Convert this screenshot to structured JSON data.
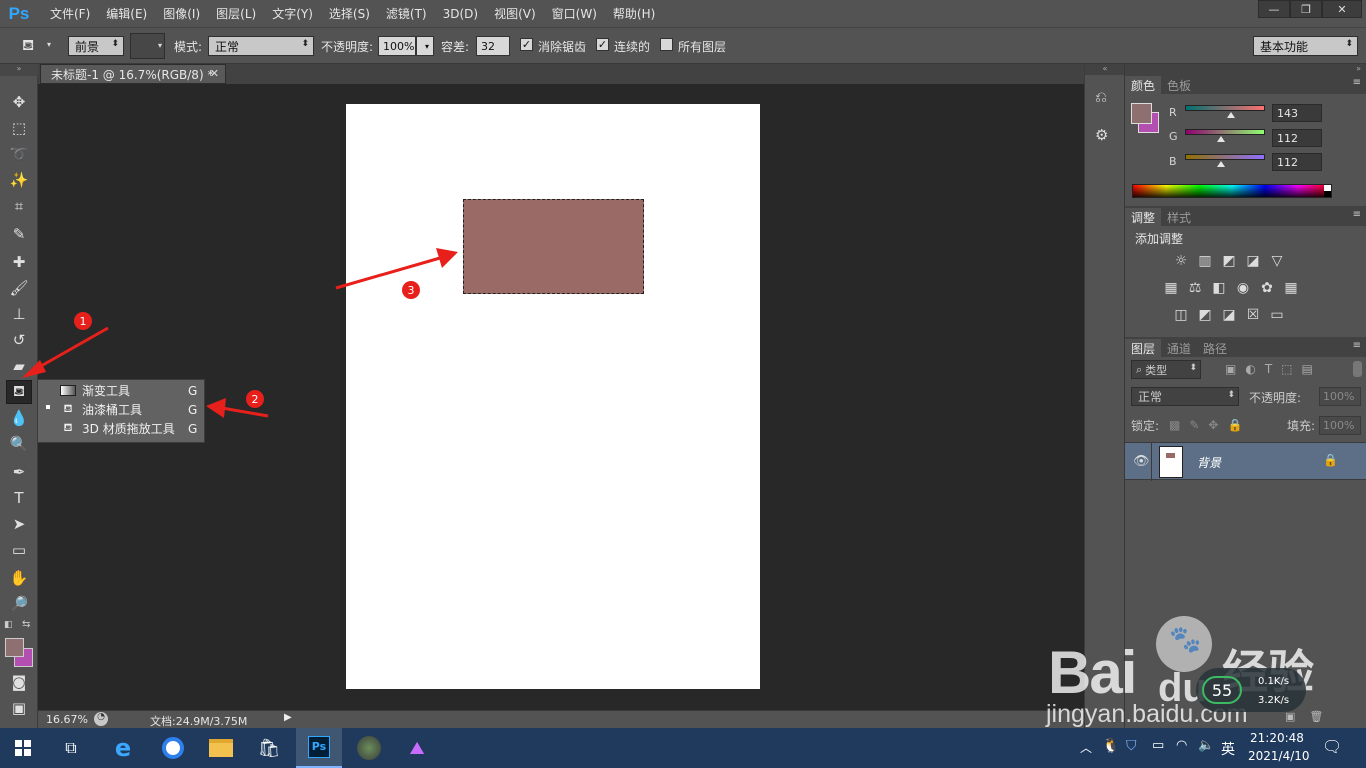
{
  "app": {
    "logo": "Ps"
  },
  "menu": [
    "文件(F)",
    "编辑(E)",
    "图像(I)",
    "图层(L)",
    "文字(Y)",
    "选择(S)",
    "滤镜(T)",
    "3D(D)",
    "视图(V)",
    "窗口(W)",
    "帮助(H)"
  ],
  "window_controls": {
    "minimize": "—",
    "restore": "❐",
    "close": "✕"
  },
  "options": {
    "fill_source": "前景",
    "mode_label": "模式:",
    "mode_value": "正常",
    "opacity_label": "不透明度:",
    "opacity_value": "100%",
    "tolerance_label": "容差:",
    "tolerance_value": "32",
    "antialias_label": "消除锯齿",
    "antialias_checked": true,
    "contiguous_label": "连续的",
    "contiguous_checked": true,
    "all_layers_label": "所有图层",
    "all_layers_checked": false,
    "workspace": "基本功能"
  },
  "document": {
    "tab_title": "未标题-1 @ 16.7%(RGB/8) *",
    "zoom": "16.67%",
    "doc_size": "文档:24.9M/3.75M",
    "fill_color": "#996a66"
  },
  "tools": [
    "move-icon",
    "marquee-icon",
    "lasso-icon",
    "magic-wand-icon",
    "crop-icon",
    "eyedropper-icon",
    "healing-icon",
    "brush-icon",
    "stamp-icon",
    "history-brush-icon",
    "eraser-icon",
    "paint-bucket-icon",
    "blur-icon",
    "dodge-icon",
    "pen-icon",
    "type-icon",
    "path-select-icon",
    "rectangle-icon",
    "hand-icon",
    "zoom-icon"
  ],
  "flyout": {
    "items": [
      {
        "label": "渐变工具",
        "shortcut": "G",
        "selected": false
      },
      {
        "label": "油漆桶工具",
        "shortcut": "G",
        "selected": true
      },
      {
        "label": "3D 材质拖放工具",
        "shortcut": "G",
        "selected": false
      }
    ]
  },
  "annotations": [
    "1",
    "2",
    "3"
  ],
  "color_panel": {
    "tabs": [
      "颜色",
      "色板"
    ],
    "channels": [
      {
        "name": "R",
        "value": "143"
      },
      {
        "name": "G",
        "value": "112"
      },
      {
        "name": "B",
        "value": "112"
      }
    ],
    "foreground": "#8f7070",
    "background": "#b34fb0"
  },
  "adjustments_panel": {
    "tabs": [
      "调整",
      "样式"
    ],
    "title": "添加调整"
  },
  "layers_panel": {
    "tabs": [
      "图层",
      "通道",
      "路径"
    ],
    "filter": "类型",
    "blend_mode": "正常",
    "opacity_label": "不透明度:",
    "opacity_value": "100%",
    "lock_label": "锁定:",
    "fill_label": "填充:",
    "fill_value": "100%",
    "layers": [
      {
        "name": "背景",
        "visible": true,
        "locked": true
      }
    ]
  },
  "taskbar": {
    "apps": [
      "windows-start-icon",
      "task-view-icon",
      "edge-icon",
      "browser-icon",
      "file-explorer-icon",
      "store-icon",
      "photoshop-icon",
      "photo-app-icon",
      "video-editor-icon"
    ],
    "ime": "英",
    "time": "21:20:48",
    "date": "2021/4/10"
  },
  "network_widget": {
    "percent": "55",
    "up": "0.1K/s",
    "down": "3.2K/s"
  },
  "watermark": {
    "brand": "Bai",
    "brand2": "du",
    "cn": "经验",
    "url": "jingyan.baidu.com"
  }
}
